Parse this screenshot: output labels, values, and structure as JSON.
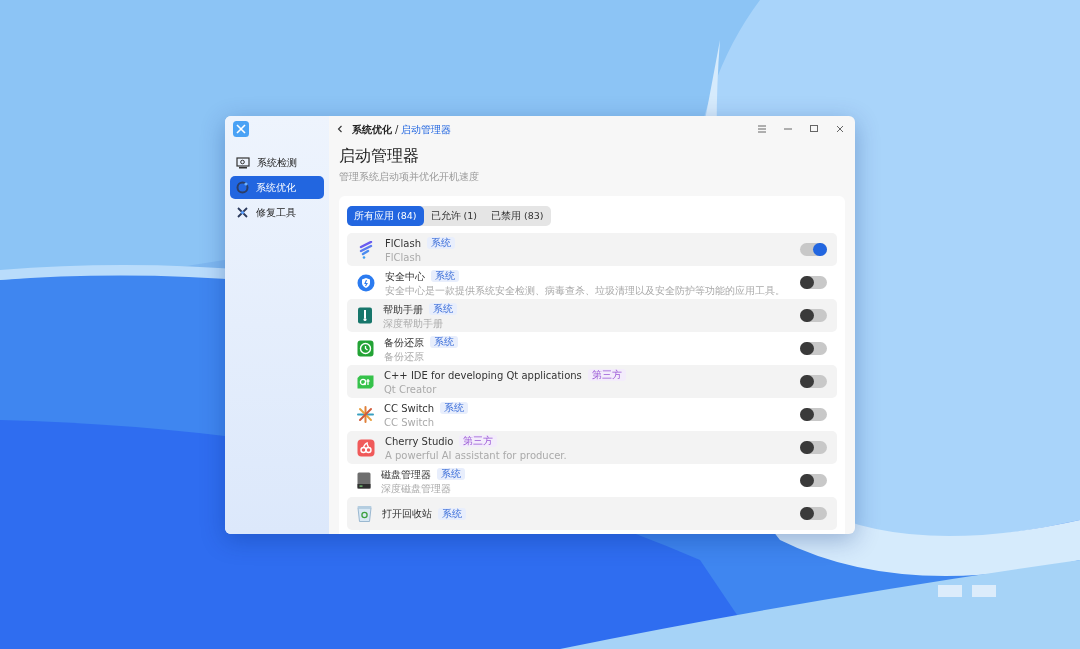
{
  "sidebar": {
    "items": [
      {
        "label": "系统检测",
        "selected": false
      },
      {
        "label": "系统优化",
        "selected": true
      },
      {
        "label": "修复工具",
        "selected": false
      }
    ]
  },
  "breadcrumb": {
    "parent": "系统优化",
    "separator": "/",
    "current": "启动管理器"
  },
  "page": {
    "title": "启动管理器",
    "subtitle": "管理系统启动项并优化开机速度"
  },
  "tabs": [
    {
      "label": "所有应用 (84)",
      "selected": true
    },
    {
      "label": "已允许 (1)",
      "selected": false
    },
    {
      "label": "已禁用 (83)",
      "selected": false
    }
  ],
  "apps": [
    {
      "name": "FlClash",
      "tag": {
        "label": "系统",
        "kind": "system"
      },
      "description": "FlClash",
      "on": true
    },
    {
      "name": "安全中心",
      "tag": {
        "label": "系统",
        "kind": "system"
      },
      "description": "安全中心是一款提供系统安全检测、病毒查杀、垃圾清理以及安全防护等功能的应用工具。",
      "on": false
    },
    {
      "name": "帮助手册",
      "tag": {
        "label": "系统",
        "kind": "system"
      },
      "description": "深度帮助手册",
      "on": false
    },
    {
      "name": "备份还原",
      "tag": {
        "label": "系统",
        "kind": "system"
      },
      "description": "备份还原",
      "on": false
    },
    {
      "name": "C++ IDE for developing Qt applications",
      "tag": {
        "label": "第三方",
        "kind": "third_party"
      },
      "description": "Qt Creator",
      "on": false
    },
    {
      "name": "CC Switch",
      "tag": {
        "label": "系统",
        "kind": "system"
      },
      "description": "CC Switch",
      "on": false
    },
    {
      "name": "Cherry Studio",
      "tag": {
        "label": "第三方",
        "kind": "third_party"
      },
      "description": "A powerful AI assistant for producer.",
      "on": false
    },
    {
      "name": "磁盘管理器",
      "tag": {
        "label": "系统",
        "kind": "system"
      },
      "description": "深度磁盘管理器",
      "on": false
    },
    {
      "name": "打开回收站",
      "tag": {
        "label": "系统",
        "kind": "system"
      },
      "on": false
    }
  ]
}
